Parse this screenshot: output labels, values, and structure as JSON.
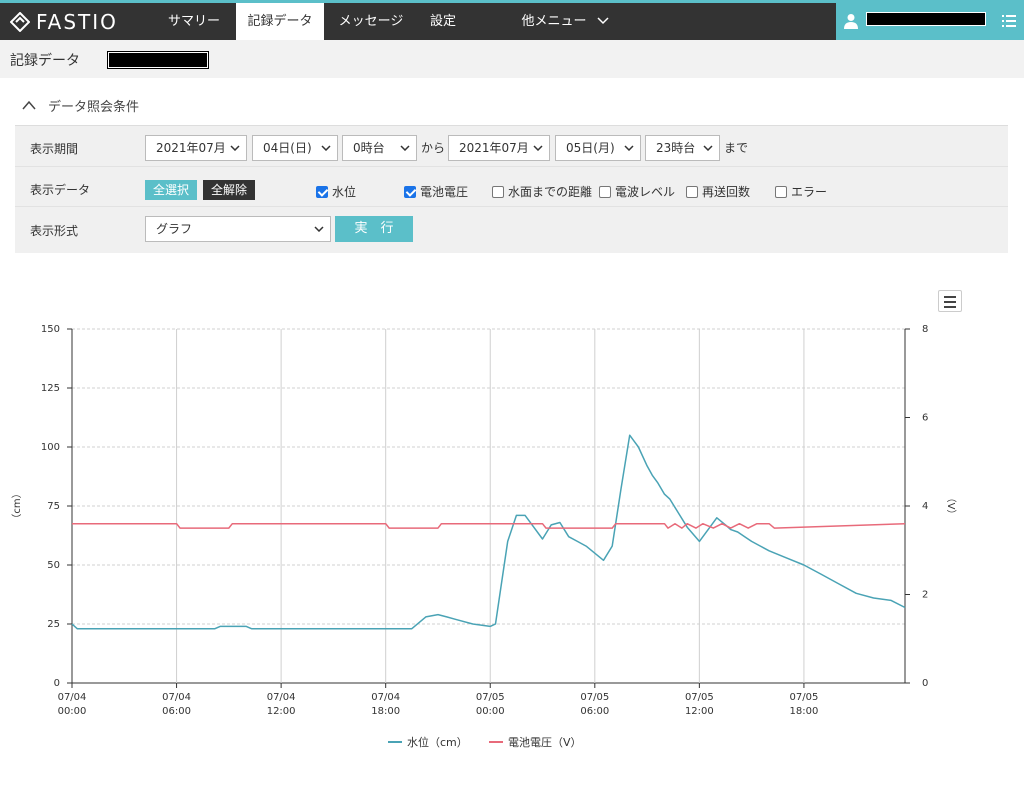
{
  "app": {
    "logo": "FASTIO"
  },
  "nav": {
    "summary": "サマリー",
    "records": "記録データ",
    "messages": "メッセージ",
    "settings": "設定",
    "other": "他メニュー"
  },
  "page": {
    "title": "記録データ"
  },
  "conditions": {
    "header": "データ照会条件",
    "period": {
      "label": "表示期間",
      "from_month": "2021年07月",
      "from_day": "04日(日)",
      "from_hour": "0時台",
      "from_text": "から",
      "to_month": "2021年07月",
      "to_day": "05日(月)",
      "to_hour": "23時台",
      "to_text": "まで"
    },
    "data": {
      "label": "表示データ",
      "select_all": "全選択",
      "clear_all": "全解除",
      "items": [
        {
          "label": "水位",
          "checked": true
        },
        {
          "label": "電池電圧",
          "checked": true
        },
        {
          "label": "水面までの距離",
          "checked": false
        },
        {
          "label": "電波レベル",
          "checked": false
        },
        {
          "label": "再送回数",
          "checked": false
        },
        {
          "label": "エラー",
          "checked": false
        }
      ]
    },
    "format": {
      "label": "表示形式",
      "value": "グラフ",
      "run": "実　行"
    }
  },
  "colors": {
    "accent": "#5bbfc9",
    "water": "#4aa3b5",
    "voltage": "#e86a7a"
  },
  "chart_data": {
    "type": "line",
    "ylabel_left": "（cm）",
    "ylabel_right": "（V）",
    "ylim_left": [
      0,
      150
    ],
    "ylim_right": [
      0,
      8
    ],
    "yticks_left": [
      "0",
      "25",
      "50",
      "75",
      "100",
      "125",
      "150"
    ],
    "yticks_right": [
      "0",
      "2",
      "4",
      "6",
      "8"
    ],
    "xticks": [
      {
        "date": "07/04",
        "time": "00:00"
      },
      {
        "date": "07/04",
        "time": "06:00"
      },
      {
        "date": "07/04",
        "time": "12:00"
      },
      {
        "date": "07/04",
        "time": "18:00"
      },
      {
        "date": "07/05",
        "time": "00:00"
      },
      {
        "date": "07/05",
        "time": "06:00"
      },
      {
        "date": "07/05",
        "time": "12:00"
      },
      {
        "date": "07/05",
        "time": "18:00"
      }
    ],
    "x_unit": "hours from 07/04 00:00",
    "xlim": [
      0,
      47.8
    ],
    "grid": true,
    "legend_position": "bottom",
    "series": [
      {
        "name": "水位（cm）",
        "axis": "left",
        "x": [
          0,
          0.3,
          2,
          6,
          8.2,
          8.5,
          9,
          10,
          10.3,
          12,
          18,
          19.5,
          20.3,
          21,
          21.5,
          22,
          23,
          24,
          24.3,
          24.6,
          25,
          25.5,
          26,
          26.5,
          27,
          27.5,
          28,
          28.5,
          29,
          29.5,
          30,
          30.5,
          31,
          31.5,
          32,
          32.5,
          33,
          33.3,
          33.6,
          34,
          34.3,
          34.8,
          35.3,
          36,
          37,
          37.5,
          37.8,
          38.2,
          38.6,
          39,
          39.5,
          40,
          41,
          42,
          43,
          44,
          45,
          46,
          47,
          47.8
        ],
        "y": [
          25,
          23,
          23,
          23,
          23,
          24,
          24,
          24,
          23,
          23,
          23,
          23,
          28,
          29,
          28,
          27,
          25,
          24,
          25,
          40,
          60,
          71,
          71,
          66,
          61,
          67,
          68,
          62,
          60,
          58,
          55,
          52,
          58,
          82,
          105,
          100,
          92,
          88,
          85,
          80,
          78,
          72,
          66,
          60,
          70,
          67,
          65,
          64,
          62,
          60,
          58,
          56,
          53,
          50,
          46,
          42,
          38,
          36,
          35,
          32
        ]
      },
      {
        "name": "電池電圧（V）",
        "axis": "right",
        "x": [
          0,
          6,
          6.2,
          9,
          9.2,
          18,
          18.2,
          21,
          21.2,
          27,
          27.2,
          31,
          31.2,
          32,
          33,
          34,
          34.2,
          34.6,
          35,
          35.3,
          35.8,
          36.2,
          36.8,
          37.3,
          37.8,
          38.3,
          38.8,
          39.3,
          40,
          40.3,
          47.8
        ],
        "y": [
          3.6,
          3.6,
          3.5,
          3.5,
          3.6,
          3.6,
          3.5,
          3.5,
          3.6,
          3.6,
          3.5,
          3.5,
          3.6,
          3.6,
          3.6,
          3.6,
          3.5,
          3.6,
          3.5,
          3.6,
          3.5,
          3.6,
          3.5,
          3.6,
          3.5,
          3.6,
          3.5,
          3.6,
          3.6,
          3.5,
          3.6
        ]
      }
    ]
  }
}
